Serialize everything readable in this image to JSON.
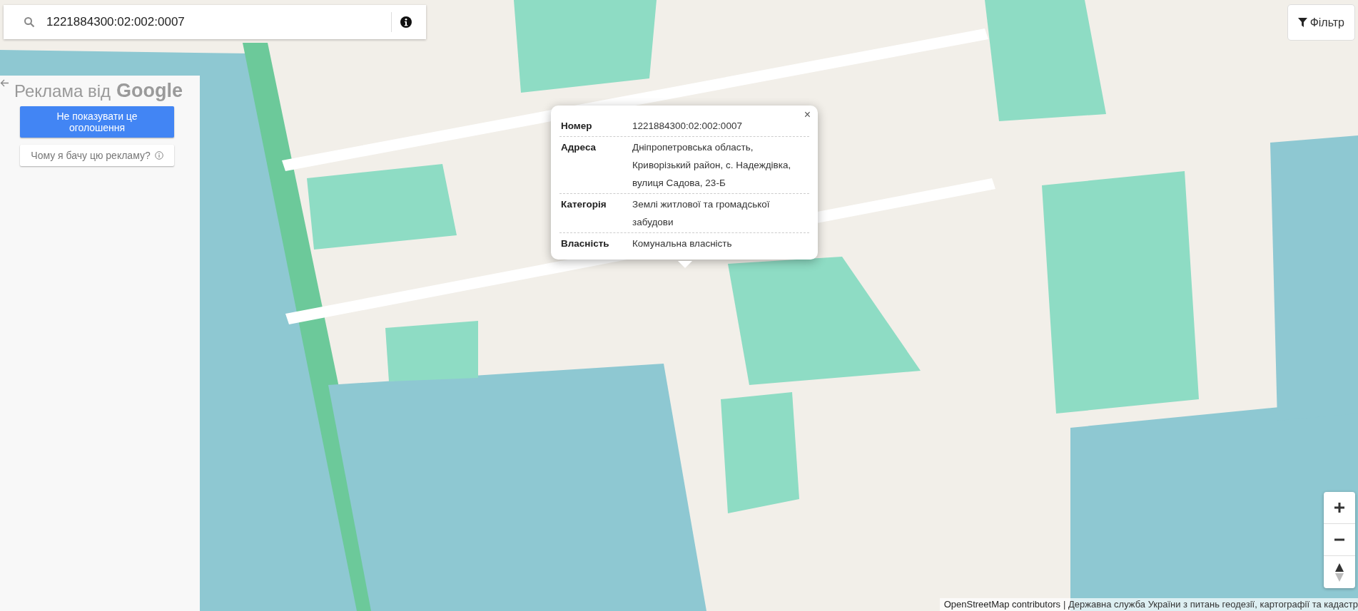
{
  "search": {
    "value": "1221884300:02:002:0007"
  },
  "filter_button": {
    "label": "Фільтр"
  },
  "ad_panel": {
    "title": "Реклама від",
    "brand": "Google",
    "hide_button": "Не показувати це оголошення",
    "why_button": "Чому я бачу цю рекламу?"
  },
  "popup": {
    "close": "×",
    "rows": [
      {
        "label": "Номер",
        "value": "1221884300:02:002:0007"
      },
      {
        "label": "Адреса",
        "value": "Дніпропетровська область, Криворізький район, с. Надеждівка, вулиця Садова, 23-Б"
      },
      {
        "label": "Категорія",
        "value": "Землі житлової та громадської забудови"
      },
      {
        "label": "Власність",
        "value": "Комунальна власність"
      }
    ]
  },
  "attribution": {
    "link": "OpenStreetMap contributors",
    "text": "| Державна служба України з питань геодезії, картографії та кадастр"
  }
}
